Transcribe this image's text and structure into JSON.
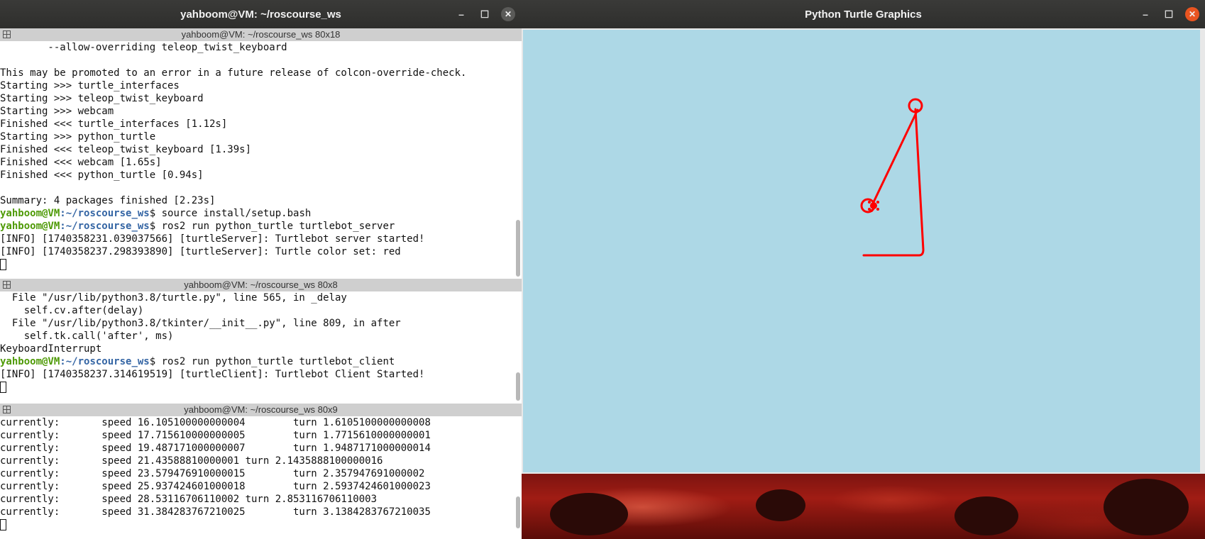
{
  "terminal": {
    "title": "yahboom@VM: ~/roscourse_ws",
    "panes": [
      {
        "header": "yahboom@VM: ~/roscourse_ws 80x18",
        "lines": [
          {
            "t": "        --allow-overriding teleop_twist_keyboard"
          },
          {
            "t": ""
          },
          {
            "t": "This may be promoted to an error in a future release of colcon-override-check."
          },
          {
            "t": "Starting >>> turtle_interfaces"
          },
          {
            "t": "Starting >>> teleop_twist_keyboard"
          },
          {
            "t": "Starting >>> webcam"
          },
          {
            "t": "Finished <<< turtle_interfaces [1.12s]"
          },
          {
            "t": "Starting >>> python_turtle"
          },
          {
            "t": "Finished <<< teleop_twist_keyboard [1.39s]"
          },
          {
            "t": "Finished <<< webcam [1.65s]"
          },
          {
            "t": "Finished <<< python_turtle [0.94s]"
          },
          {
            "t": ""
          },
          {
            "t": "Summary: 4 packages finished [2.23s]"
          },
          {
            "user": "yahboom@VM",
            "path": ":~/roscourse_ws",
            "cmd": "$ source install/setup.bash"
          },
          {
            "user": "yahboom@VM",
            "path": ":~/roscourse_ws",
            "cmd": "$ ros2 run python_turtle turtlebot_server"
          },
          {
            "t": "[INFO] [1740358231.039037566] [turtleServer]: Turtlebot server started!"
          },
          {
            "t": "[INFO] [1740358237.298393890] [turtleServer]: Turtle color set: red"
          },
          {
            "cursor": true
          }
        ]
      },
      {
        "header": "yahboom@VM: ~/roscourse_ws 80x8",
        "lines": [
          {
            "t": "  File \"/usr/lib/python3.8/turtle.py\", line 565, in _delay"
          },
          {
            "t": "    self.cv.after(delay)"
          },
          {
            "t": "  File \"/usr/lib/python3.8/tkinter/__init__.py\", line 809, in after"
          },
          {
            "t": "    self.tk.call('after', ms)"
          },
          {
            "t": "KeyboardInterrupt"
          },
          {
            "user": "yahboom@VM",
            "path": ":~/roscourse_ws",
            "cmd": "$ ros2 run python_turtle turtlebot_client"
          },
          {
            "t": "[INFO] [1740358237.314619519] [turtleClient]: Turtlebot Client Started!"
          },
          {
            "cursor": true
          }
        ]
      },
      {
        "header": "yahboom@VM: ~/roscourse_ws 80x9",
        "lines": [
          {
            "t": "currently:       speed 16.105100000000004        turn 1.6105100000000008"
          },
          {
            "t": "currently:       speed 17.715610000000005        turn 1.7715610000000001"
          },
          {
            "t": "currently:       speed 19.487171000000007        turn 1.9487171000000014"
          },
          {
            "t": "currently:       speed 21.43588810000001 turn 2.1435888100000016"
          },
          {
            "t": "currently:       speed 23.579476910000015        turn 2.357947691000002"
          },
          {
            "t": "currently:       speed 25.937424601000018        turn 2.5937424601000023"
          },
          {
            "t": "currently:       speed 28.53116706110002 turn 2.853116706110003"
          },
          {
            "t": "currently:       speed 31.384283767210025        turn 3.1384283767210035"
          },
          {
            "cursor": true
          }
        ]
      }
    ]
  },
  "turtle_window": {
    "title": "Python Turtle Graphics",
    "canvas_bg": "#add8e6",
    "pen_color": "#ff0000"
  },
  "window_controls": {
    "minimize": "–",
    "maximize": "☐",
    "close": "✕"
  }
}
